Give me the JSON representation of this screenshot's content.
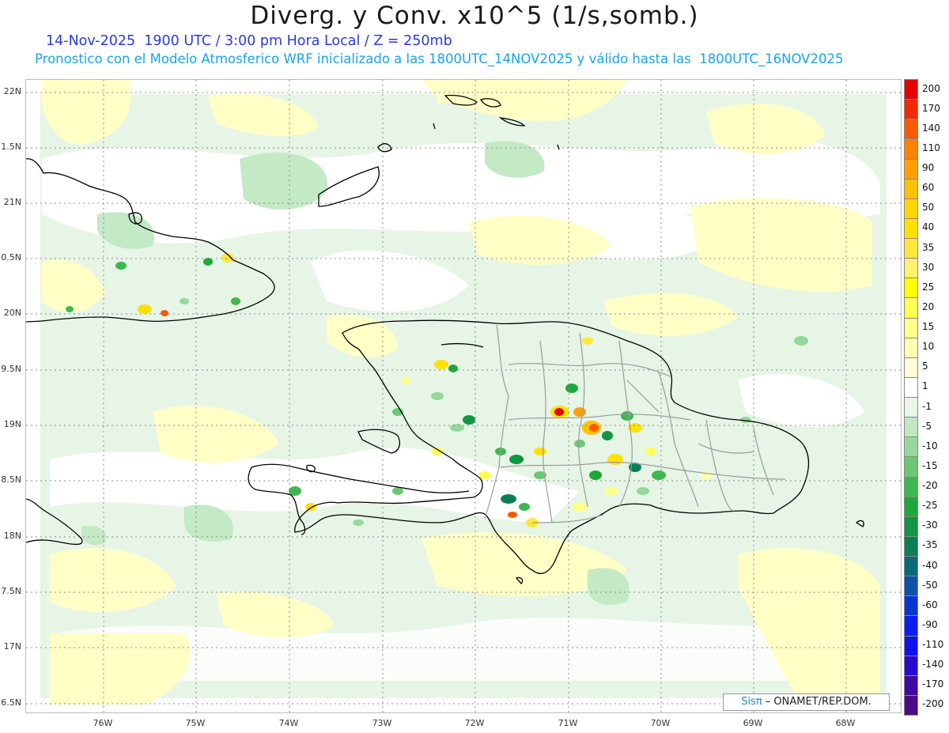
{
  "header": {
    "title": "Diverg. y Conv. x10^5 (1/s,somb.)",
    "datetime_line": "14-Nov-2025  1900 UTC / 3:00 pm Hora Local / Z = 250mb",
    "model_line": "Pronostico con el Modelo Atmosferico WRF inicializado a las 1800UTC_14NOV2025 y válido hasta las  1800UTC_16NOV2025"
  },
  "map": {
    "lat_labels": [
      "22N",
      "1.5N",
      "21N",
      "0.5N",
      "20N",
      "9.5N",
      "19N",
      "8.5N",
      "18N",
      "7.5N",
      "17N",
      "6.5N"
    ],
    "lon_labels": [
      "76W",
      "75W",
      "74W",
      "73W",
      "72W",
      "71W",
      "70W",
      "69W",
      "68W"
    ],
    "region": "Hispaniola, eastern Cuba, southern Bahamas",
    "gridlines": true
  },
  "colorbar": {
    "labels": [
      "200",
      "170",
      "140",
      "110",
      "90",
      "60",
      "50",
      "40",
      "35",
      "30",
      "25",
      "20",
      "15",
      "10",
      "5",
      "1",
      "-1",
      "-5",
      "-10",
      "-15",
      "-20",
      "-25",
      "-30",
      "-35",
      "-40",
      "-50",
      "-60",
      "-90",
      "-110",
      "-140",
      "-170",
      "-200"
    ],
    "colors": [
      "#e60000",
      "#f22a00",
      "#fa5a00",
      "#ff8200",
      "#ffa000",
      "#ffc000",
      "#ffd700",
      "#ffe100",
      "#ffe83a",
      "#fff06e",
      "#ffff00",
      "#ffff55",
      "#ffff8c",
      "#ffffb4",
      "#ffffd7",
      "#ffffff",
      "#e8f6e8",
      "#bfe8c0",
      "#96d89a",
      "#6ac873",
      "#3db84f",
      "#1fa83a",
      "#0f9640",
      "#0a7f55",
      "#0b6a78",
      "#0b52a8",
      "#0a36d0",
      "#0a1ef0",
      "#1010f0",
      "#2a0ad0",
      "#3d08a8",
      "#4b0a88"
    ]
  },
  "credit": {
    "logo": "Sisπ",
    "text": " – ONAMET/REP.DOM."
  }
}
